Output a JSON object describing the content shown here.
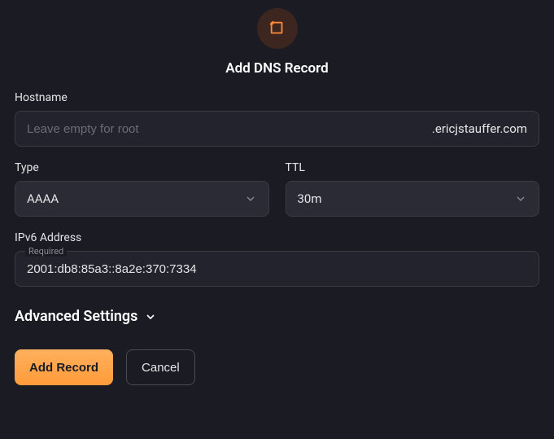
{
  "title": "Add DNS Record",
  "hostname": {
    "label": "Hostname",
    "placeholder": "Leave empty for root",
    "value": "",
    "suffix": ".ericjstauffer.com"
  },
  "type": {
    "label": "Type",
    "value": "AAAA"
  },
  "ttl": {
    "label": "TTL",
    "value": "30m"
  },
  "ipv6": {
    "label": "IPv6 Address",
    "floatLabel": "Required",
    "value": "2001:db8:85a3::8a2e:370:7334"
  },
  "advanced": {
    "label": "Advanced Settings"
  },
  "actions": {
    "primary": "Add Record",
    "secondary": "Cancel"
  }
}
